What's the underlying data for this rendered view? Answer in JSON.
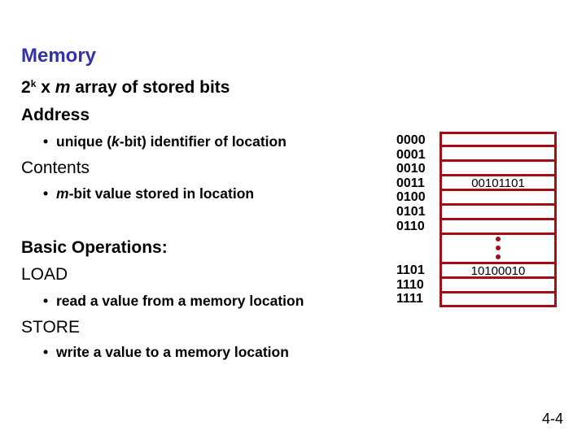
{
  "slide": {
    "title": "Memory",
    "lines": {
      "array_prefix": "2",
      "array_sup": "k",
      "array_x": " x ",
      "array_m": "m",
      "array_rest": " array of stored bits",
      "address": "Address",
      "address_bullet_pre": "unique (",
      "address_bullet_k": "k",
      "address_bullet_post": "-bit) identifier of location",
      "contents": "Contents",
      "contents_bullet_m": "m",
      "contents_bullet_post": "-bit value stored in location",
      "basic_ops": "Basic Operations:",
      "load": "LOAD",
      "load_bullet": "read a value from a memory location",
      "store": "STORE",
      "store_bullet": "write a value to a memory location"
    },
    "bullet_glyph": "•",
    "page_number": "4-4"
  },
  "memory_diagram": {
    "addresses_top": [
      "0000",
      "0001",
      "0010",
      "0011",
      "0100",
      "0101",
      "0110"
    ],
    "addresses_bottom": [
      "1101",
      "1110",
      "1111"
    ],
    "value_0011": "00101101",
    "value_1101": "10100010",
    "ellipsis": "vertical-dots",
    "border_color": "#a50f14"
  }
}
